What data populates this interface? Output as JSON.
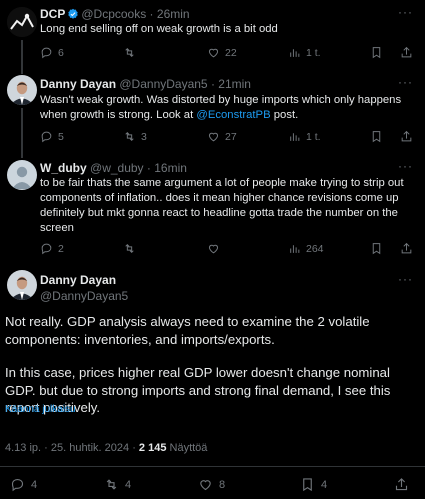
{
  "tweets": [
    {
      "name": "DCP",
      "verified": true,
      "handle": "@Dcpcooks",
      "time": "26min",
      "text": "Long end selling off on weak growth is a bit odd",
      "replies": "6",
      "retweets": "",
      "likes": "22",
      "views": "1 t."
    },
    {
      "name": "Danny Dayan",
      "handle": "@DannyDayan5",
      "time": "21min",
      "text_before": "Wasn't weak growth. Was distorted by huge imports which only happens when growth is strong. Look at ",
      "mention": "@EconstratPB",
      "text_after": " post.",
      "replies": "5",
      "retweets": "3",
      "likes": "27",
      "views": "1 t."
    },
    {
      "name": "W_duby",
      "handle": "@w_duby",
      "time": "16min",
      "text": "to be fair thats the same argument a lot of people make trying to strip out components of inflation.. does it mean higher chance revisions come up definitely but mkt gonna react to headline gotta trade the number on the screen",
      "replies": "2",
      "retweets": "",
      "likes": "",
      "views": "264"
    }
  ],
  "main_tweet": {
    "name": "Danny Dayan",
    "handle": "@DannyDayan5",
    "paragraph1": "Not really. GDP analysis always need to examine the 2 volatile components: inventories, and imports/exports.",
    "paragraph2": "In this case, prices higher real GDP lower doesn't change nominal GDP. but due to strong imports and strong final demand, I see this report positively.",
    "translate": "Käännä julkaisu",
    "timestamp": "4.13 ip. · 25. huhtik. 2024 · ",
    "views_count": "2 145",
    "views_label": " Näyttöä",
    "replies": "4",
    "retweets": "4",
    "likes": "8",
    "bookmarks": "4"
  },
  "more_label": "···",
  "colors": {
    "accent": "#1d9bf0",
    "muted": "#71767b",
    "background": "#000000"
  }
}
